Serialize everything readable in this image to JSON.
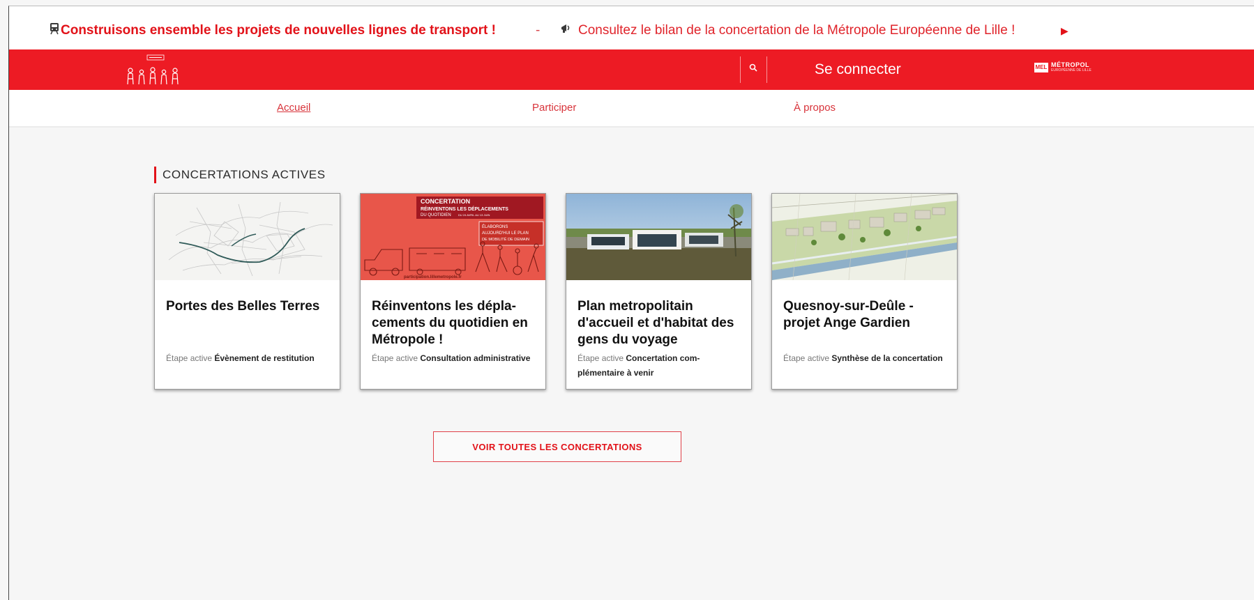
{
  "ticker": {
    "first_text": "Construisons ensemble les projets de nouvelles lignes de transport !",
    "separator": "-",
    "second_text": "Consultez le bilan de la concertation de la Métropole Européenne de Lille !",
    "first_icon": "train-icon",
    "second_icon": "megaphone-icon",
    "play_icon": "play-icon"
  },
  "header": {
    "logo_alt": "people-logo",
    "login_label": "Se connecter",
    "search_icon": "search-icon",
    "mel_logo_text": "MÉTROPOL",
    "brand_color": "#ed1b24"
  },
  "nav": {
    "items": [
      {
        "label": "Accueil",
        "active": true
      },
      {
        "label": "Participer",
        "active": false
      },
      {
        "label": "À propos",
        "active": false
      }
    ]
  },
  "section": {
    "title": "CONCERTATIONS ACTIVES"
  },
  "cards": [
    {
      "title": "Portes des Belles Terres",
      "step_label": "Étape active",
      "step_value": "Évènement de restitution",
      "image": "map-image"
    },
    {
      "title": "Réinventons les dépla-cements du quotidien en Métropole !",
      "step_label": "Étape active",
      "step_value": "Consultation administrative",
      "image": "concertation-poster",
      "poster": {
        "headline": "CONCERTATION",
        "line1": "RÉINVENTONS LES DÉPLACEMENTS",
        "line2": "DU QUOTIDIEN",
        "dates": "DU 24 AVRIL AU 13 JUIN",
        "bubble1": "ÉLABORONS",
        "bubble2": "AUJOURD'HUI LE PLAN",
        "bubble3": "DE MOBILITÉ DE DEMAIN",
        "url": "participation.lillemetropole.fr"
      }
    },
    {
      "title": "Plan metropolitain d'accueil et d'habitat des gens du voyage",
      "step_label": "Étape active",
      "step_value": "Concertation com-plémentaire à venir",
      "image": "building-photo"
    },
    {
      "title": "Quesnoy-sur-Deûle - projet Ange Gardien",
      "step_label": "Étape active",
      "step_value": "Synthèse de la concertation",
      "image": "aerial-plan"
    }
  ],
  "cta": {
    "label": "VOIR TOUTES LES CONCERTATIONS"
  }
}
